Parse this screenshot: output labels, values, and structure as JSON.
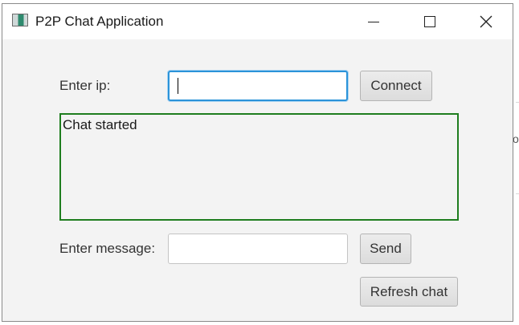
{
  "window": {
    "title": "P2P Chat Application",
    "icons": {
      "app": "app-window-icon",
      "minimize": "minimize-icon",
      "maximize": "maximize-icon",
      "close": "close-icon"
    }
  },
  "connection": {
    "ip_label": "Enter ip:",
    "ip_value": "",
    "connect_label": "Connect"
  },
  "chat": {
    "log_text": "Chat started",
    "border_color": "#1e7d1e"
  },
  "message": {
    "label": "Enter message:",
    "value": "",
    "send_label": "Send",
    "refresh_label": "Refresh chat"
  },
  "colors": {
    "focus_ring": "#2b93d9",
    "window_bg": "#f3f3f3"
  }
}
